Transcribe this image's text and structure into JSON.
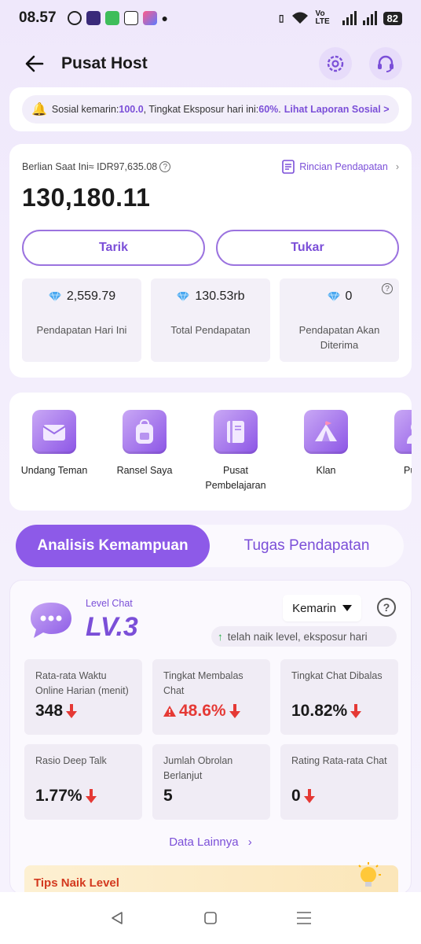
{
  "status_bar": {
    "time": "08.57",
    "network": "Vo LTE",
    "battery": "82"
  },
  "header": {
    "title": "Pusat Host"
  },
  "notice": {
    "prefix": "Sosial kemarin: ",
    "social_value": "100.0",
    "middle": ", Tingkat Eksposur hari ini: ",
    "exposure_value": "60%",
    "middle2": ".",
    "link": "Lihat Laporan Sosial >"
  },
  "balance": {
    "label": "Berlian Saat Ini≈ IDR97,635.08",
    "details_link": "Rincian Pendapatan",
    "amount": "130,180.11",
    "withdraw": "Tarik",
    "exchange": "Tukar",
    "stats": [
      {
        "value": "2,559.79",
        "label": "Pendapatan Hari Ini"
      },
      {
        "value": "130.53rb",
        "label": "Total Pendapatan"
      },
      {
        "value": "0",
        "label": "Pendapatan Akan Diterima"
      }
    ]
  },
  "shortcuts": [
    {
      "label": "Undang Teman",
      "icon": "envelope-icon"
    },
    {
      "label": "Ransel Saya",
      "icon": "backpack-icon"
    },
    {
      "label": "Pusat Pembelajaran",
      "icon": "book-icon"
    },
    {
      "label": "Klan",
      "icon": "tent-icon"
    },
    {
      "label": "Pusat",
      "icon": "person-icon"
    }
  ],
  "tabs": [
    {
      "label": "Analisis Kemampuan",
      "active": true
    },
    {
      "label": "Tugas Pendapatan",
      "active": false
    }
  ],
  "analysis": {
    "level_title": "Level Chat",
    "level": "LV.3",
    "period": "Kemarin",
    "marquee": "telah naik level, eksposur hari",
    "metrics": [
      {
        "label": "Rata-rata Waktu Online Harian (menit)",
        "value": "348",
        "trend": "down",
        "warn": false
      },
      {
        "label": "Tingkat Membalas Chat",
        "value": "48.6%",
        "trend": "down",
        "warn": true
      },
      {
        "label": "Tingkat Chat Dibalas",
        "value": "10.82%",
        "trend": "down",
        "warn": false
      },
      {
        "label": "Rasio Deep Talk",
        "value": "1.77%",
        "trend": "down",
        "warn": false
      },
      {
        "label": "Jumlah Obrolan Berlanjut",
        "value": "5",
        "trend": "none",
        "warn": false
      },
      {
        "label": "Rating Rata-rata Chat",
        "value": "0",
        "trend": "down",
        "warn": false
      }
    ],
    "more_link": "Data Lainnya",
    "tips_title": "Tips Naik Level"
  },
  "colors": {
    "accent": "#8d5ae8",
    "accent_text": "#7b4fd8",
    "down": "#e53935",
    "up": "#2ab04a"
  }
}
